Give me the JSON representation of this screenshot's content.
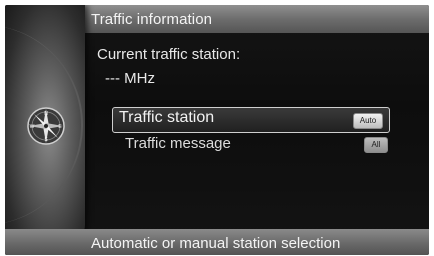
{
  "header": {
    "title": "Traffic information"
  },
  "content": {
    "current_station_label": "Current traffic station:",
    "frequency": "--- MHz"
  },
  "menu": {
    "items": [
      {
        "label": "Traffic station",
        "value": "Auto",
        "selected": true
      },
      {
        "label": "Traffic message",
        "value": "All",
        "selected": false
      }
    ]
  },
  "footer": {
    "help_text": "Automatic or manual station selection"
  },
  "compass": {
    "icon": "compass-icon",
    "directions": [
      "N",
      "E",
      "S",
      "W"
    ]
  },
  "colors": {
    "background": "#101010",
    "bar": "#6d6d6d",
    "text": "#f2f2f2"
  }
}
